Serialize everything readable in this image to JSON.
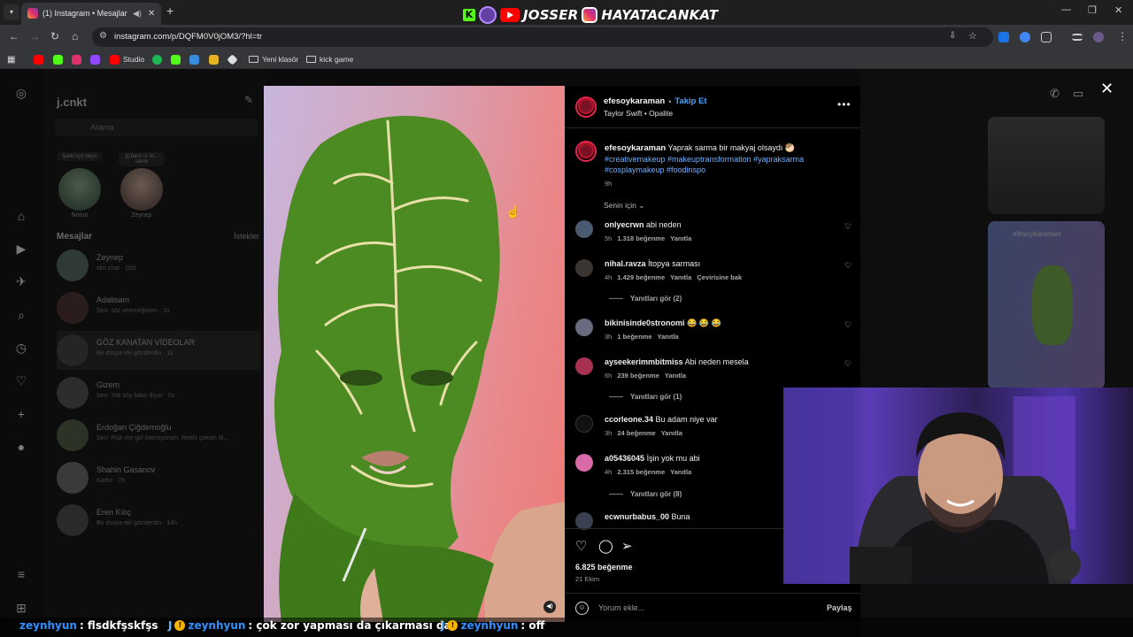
{
  "browser": {
    "tab_title": "(1) Instagram • Mesajlar",
    "url": "instagram.com/p/DQFM0V0jOM3/?hl=tr",
    "bookmarks": [
      "Studio",
      "Yeni klasör",
      "kick game"
    ]
  },
  "stream_overlay": {
    "brand_1": "JOSSER",
    "brand_2": "HAYATACANKAT"
  },
  "dm_panel": {
    "account": "j.cnkt",
    "search_placeholder": "Arama",
    "notes": [
      {
        "bubble": "Şarkı için taşın",
        "name": "Notun"
      },
      {
        "bubble": "||| back to fri... sanık",
        "name": "Zeynep"
      }
    ],
    "messages_heading": "Mesajlar",
    "requests_heading": "İstekler",
    "conversations": [
      {
        "name": "Zeynep",
        "preview": "slm chat · 20d"
      },
      {
        "name": "Adalisam",
        "preview": "Sen: söz vereceğiyem · 1s"
      },
      {
        "name": "GÖZ KANATAN VİDEOLAR",
        "preview": "Bir dosya eki gönderdin · 1s"
      },
      {
        "name": "Gizem",
        "preview": "Sen: Yok köy falan diyor · 5s"
      },
      {
        "name": "Erdoğan Çiğdemoğlu",
        "preview": "Sen: Pick me girl istemiyorum. Reels çeksin di..."
      },
      {
        "name": "Shahin Gasanov",
        "preview": "Kadın · 2h"
      },
      {
        "name": "Eren Kılıç",
        "preview": "Bir dosya eki gönderdin · 14h"
      }
    ]
  },
  "post": {
    "username": "efesoykaraman",
    "follow_label": "Takip Et",
    "audio": "Taylor Swift • Opalite",
    "caption": "Yaprak sarma bir makyaj olsaydı 🥙",
    "hashtags": "#creativemakeup #makeuptransformation #yapraksarma #cosplaymakeup #foodinspo",
    "caption_time": "9h",
    "filter_label": "Senin için",
    "comments": [
      {
        "user": "onlyecrwn",
        "text": "abi neden",
        "time": "5h",
        "likes": "1.318 beğenme",
        "reply": "Yanıtla",
        "translate": ""
      },
      {
        "user": "nihal.ravza",
        "text": "İtopya sarması",
        "time": "4h",
        "likes": "1.429 beğenme",
        "reply": "Yanıtla",
        "translate": "Çevirisine bak"
      },
      {
        "user": "bikinisinde0stronomi",
        "text": "😂 😂 😂",
        "time": "3h",
        "likes": "1 beğenme",
        "reply": "Yanıtla",
        "translate": ""
      },
      {
        "user": "ayseekerimmbitmiss",
        "text": "Abi neden mesela",
        "time": "6h",
        "likes": "239 beğenme",
        "reply": "Yanıtla",
        "translate": ""
      },
      {
        "user": "ccorleone.34",
        "text": "Bu adam niye var",
        "time": "3h",
        "likes": "24 beğenme",
        "reply": "Yanıtla",
        "translate": ""
      },
      {
        "user": "a05436045",
        "text": "İşin yok mu abi",
        "time": "4h",
        "likes": "2.315 beğenme",
        "reply": "Yanıtla",
        "translate": ""
      },
      {
        "user": "ecwnurbabus_00",
        "text": "Buna",
        "time": "",
        "likes": "",
        "reply": "",
        "translate": ""
      }
    ],
    "replies": [
      "Yanıtları gör (2)",
      "Yanıtları gör (1)",
      "Yanıtları gör (8)"
    ],
    "likes_total": "6.825 beğenme",
    "date": "21 Ekim",
    "comment_placeholder": "Yorum ekle...",
    "share_label": "Paylaş"
  },
  "side_thumb_user": "efesoykaraman",
  "chat": [
    {
      "user": "zeynhyun",
      "text": ": flsdkfşskfşs"
    },
    {
      "user": "zeynhyun",
      "text": ": çok zor yapması da çıkarması da"
    },
    {
      "user": "zeynhyun",
      "text": ": off"
    }
  ],
  "colors": {
    "accent_blue": "#4aa3ff",
    "hashtag": "#6fb0ff",
    "chat_user": "#2f8fff"
  }
}
